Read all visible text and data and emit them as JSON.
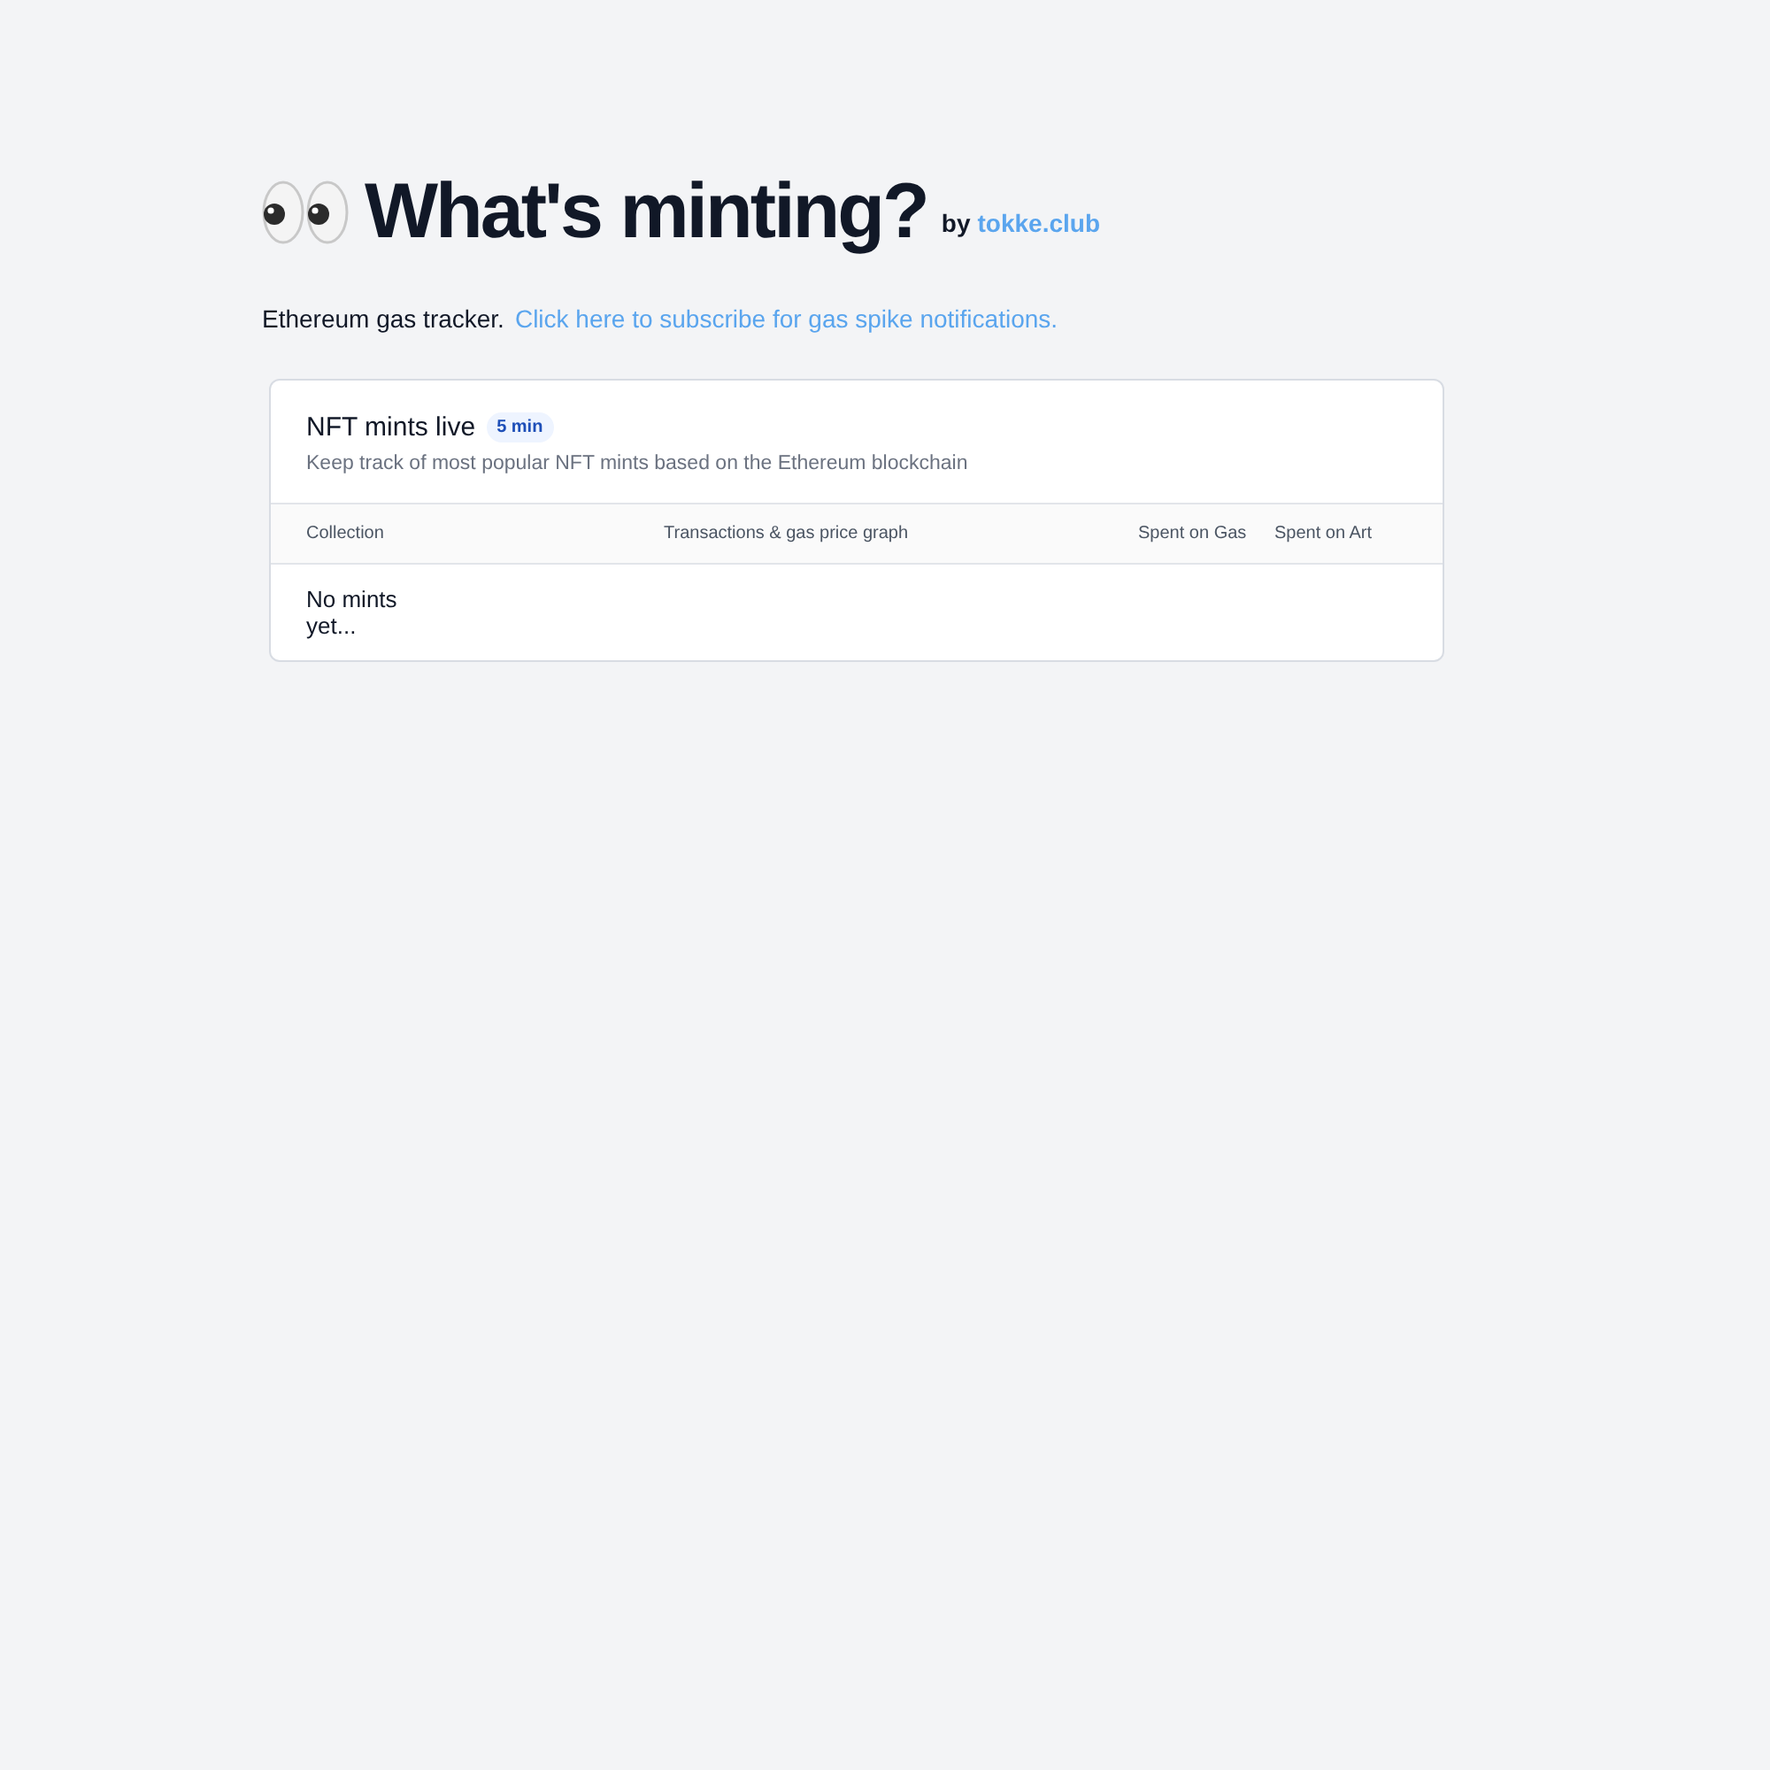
{
  "header": {
    "title": "What's minting?",
    "by": "by",
    "author_link": "tokke.club"
  },
  "intro": {
    "text": "Ethereum gas tracker.",
    "link": "Click here to subscribe for gas spike notifications."
  },
  "card": {
    "title": "NFT mints live",
    "badge": "5 min",
    "subtitle": "Keep track of most popular NFT mints based on the Ethereum blockchain",
    "columns": [
      "Collection",
      "Transactions & gas price graph",
      "Spent on Gas",
      "Spent on Art"
    ],
    "empty_message": "No mints yet..."
  }
}
